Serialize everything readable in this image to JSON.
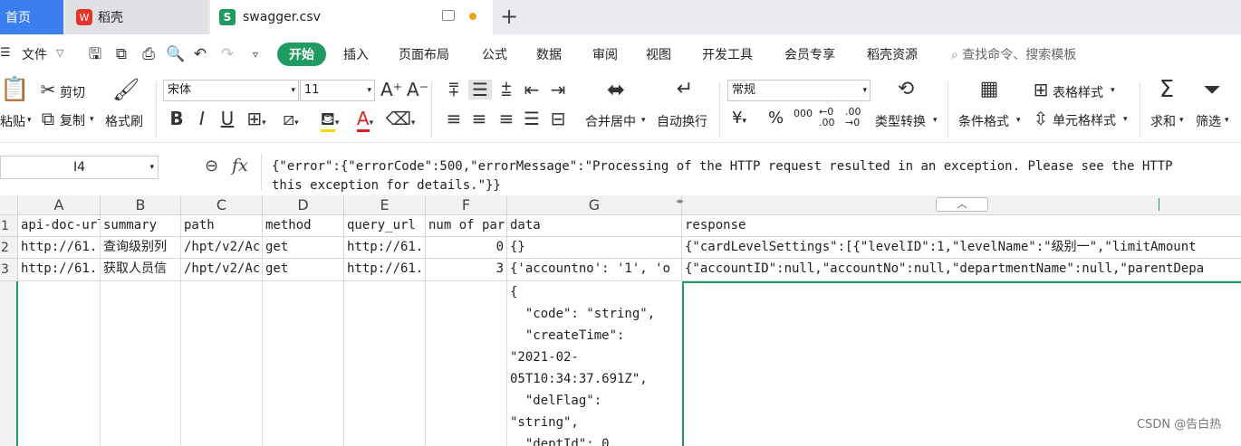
{
  "tabs": {
    "home": "首页",
    "wps": "稻壳",
    "file": "swagger.csv",
    "file_icon_letter": "S"
  },
  "menu": {
    "file": "文件",
    "items": [
      "开始",
      "插入",
      "页面布局",
      "公式",
      "数据",
      "审阅",
      "视图",
      "开发工具",
      "会员专享",
      "稻壳资源"
    ],
    "search": "查找命令、搜索模板"
  },
  "ribbon": {
    "paste": "粘贴",
    "cut": "剪切",
    "copy": "复制",
    "format_painter": "格式刷",
    "font_name": "宋体",
    "font_size": "11",
    "number_format": "常规",
    "merge_center": "合并居中",
    "wrap_text": "自动换行",
    "type_convert": "类型转换",
    "conditional_format": "条件格式",
    "table_style": "表格样式",
    "cell_style": "单元格样式",
    "sum": "求和",
    "filter": "筛选",
    "currency": "¥",
    "percent": "%",
    "thousands": "000",
    "dec_add": "←0 .00",
    "dec_remove": ".00 →0"
  },
  "formula_bar": {
    "cell_ref": "I4",
    "fx": "fx",
    "content": "{\"error\":{\"errorCode\":500,\"errorMessage\":\"Processing of the HTTP request resulted in an exception. Please see the HTTP\nthis exception for details.\"}}"
  },
  "grid": {
    "columns": [
      "A",
      "B",
      "C",
      "D",
      "E",
      "F",
      "G"
    ],
    "rows": [
      "1",
      "2",
      "3"
    ],
    "header_row": [
      "api-doc-url",
      "summary",
      "path",
      "method",
      "query_url",
      "num of par",
      "data",
      "response"
    ],
    "row2": [
      "http://61.",
      "查询级别列",
      "/hpt/v2/Ac",
      "get",
      "http://61.",
      "0",
      "{}",
      "{\"cardLevelSettings\":[{\"levelID\":1,\"levelName\":\"级别一\",\"limitAmount"
    ],
    "row3": [
      "http://61.",
      "获取人员信",
      "/hpt/v2/Ac",
      "get",
      "http://61.",
      "3",
      "{'accountno': '1', 'o",
      "{\"accountID\":null,\"accountNo\":null,\"departmentName\":null,\"parentDepa"
    ],
    "g_multiline": "{\n  \"code\": \"string\",\n  \"createTime\":\n\"2021-02-\n05T10:34:37.691Z\",\n  \"delFlag\":\n\"string\",\n  \"deptId\": 0,"
  },
  "watermark": "CSDN @告白热",
  "colors": {
    "accent_green": "#1f9b5f",
    "home_tab_blue": "#3b7ef0"
  }
}
